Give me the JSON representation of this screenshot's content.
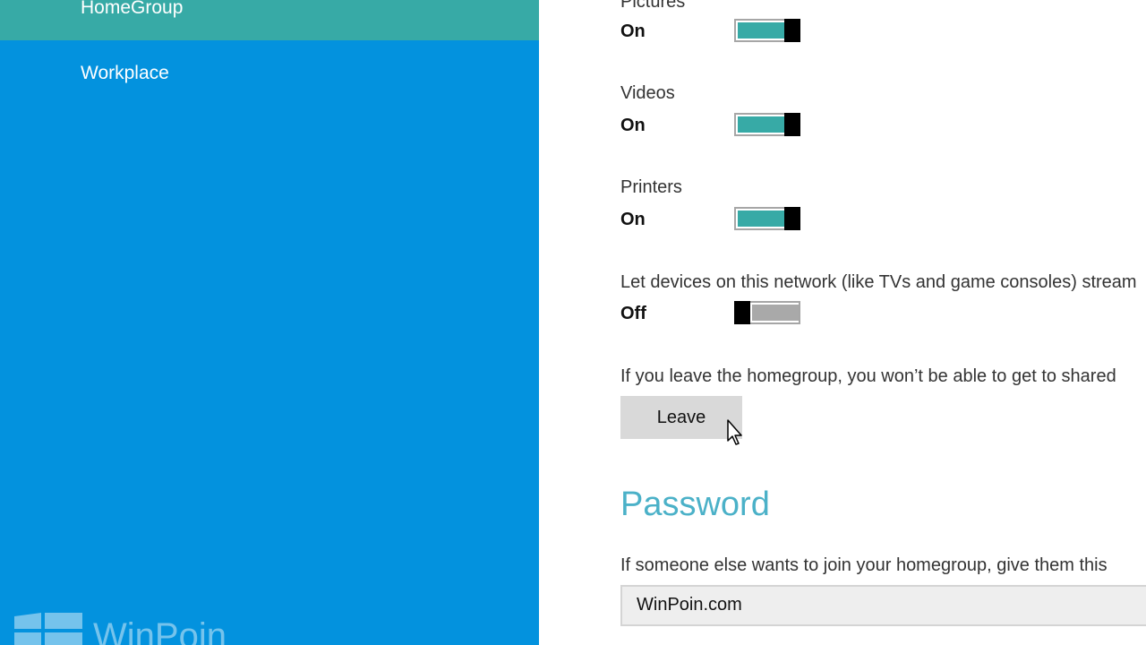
{
  "nav": {
    "items": [
      {
        "label": "HomeGroup",
        "selected": true
      },
      {
        "label": "Workplace",
        "selected": false
      }
    ],
    "watermark_text": "WinPoin"
  },
  "settings": {
    "pictures": {
      "label": "Pictures",
      "state": "On",
      "on": true
    },
    "videos": {
      "label": "Videos",
      "state": "On",
      "on": true
    },
    "printers": {
      "label": "Printers",
      "state": "On",
      "on": true
    },
    "stream": {
      "label": "Let devices on this network (like TVs and game consoles) stream",
      "state": "Off",
      "on": false
    }
  },
  "leave": {
    "description": "If you leave the homegroup, you won’t be able to get to shared",
    "button_label": "Leave"
  },
  "password": {
    "section_title": "Password",
    "description": "If someone else wants to join your homegroup, give them this",
    "value": "WinPoin.com"
  },
  "colors": {
    "nav_background": "#0392de",
    "nav_selected": "#37aaa6",
    "toggle_on": "#37aaa6",
    "toggle_off": "#a9a9a9",
    "accent_title": "#4bb1c8"
  }
}
